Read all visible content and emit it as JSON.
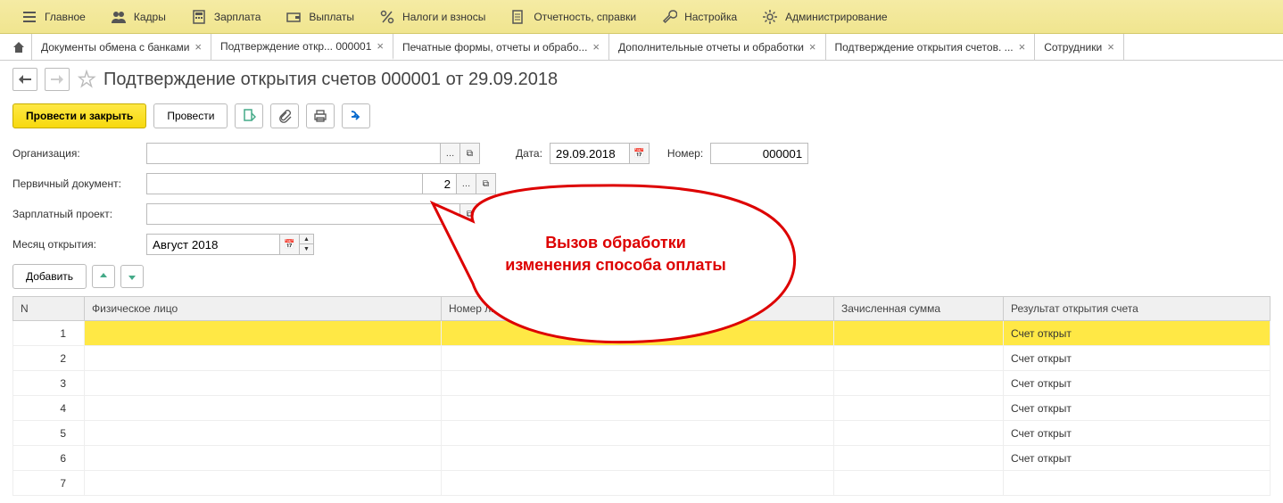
{
  "topmenu": [
    {
      "label": "Главное",
      "icon": "menu"
    },
    {
      "label": "Кадры",
      "icon": "people"
    },
    {
      "label": "Зарплата",
      "icon": "calc"
    },
    {
      "label": "Выплаты",
      "icon": "wallet"
    },
    {
      "label": "Налоги и взносы",
      "icon": "percent"
    },
    {
      "label": "Отчетность, справки",
      "icon": "report"
    },
    {
      "label": "Настройка",
      "icon": "wrench"
    },
    {
      "label": "Администрирование",
      "icon": "gear"
    }
  ],
  "tabs": [
    {
      "label": "Документы обмена с банками",
      "active": false
    },
    {
      "label": "Подтверждение откр...           000001",
      "active": true
    },
    {
      "label": "Печатные формы, отчеты и обрабо...",
      "active": false
    },
    {
      "label": "Дополнительные отчеты и обработки",
      "active": false
    },
    {
      "label": "Подтверждение открытия счетов. ...",
      "active": false
    },
    {
      "label": "Сотрудники",
      "active": false
    }
  ],
  "page": {
    "title": "Подтверждение открытия счетов        000001 от 29.09.2018",
    "buttons": {
      "primary": "Провести и закрыть",
      "secondary": "Провести",
      "add": "Добавить"
    }
  },
  "form": {
    "org_label": "Организация:",
    "org_value": "",
    "date_label": "Дата:",
    "date_value": "29.09.2018",
    "number_label": "Номер:",
    "number_value": "        000001",
    "primdoc_label": "Первичный документ:",
    "primdoc_value": "",
    "primdoc_value2": "2",
    "project_label": "Зарплатный проект:",
    "project_value": "",
    "month_label": "Месяц открытия:",
    "month_value": "Август 2018"
  },
  "callout": {
    "line1": "Вызов обработки",
    "line2": "изменения способа оплаты"
  },
  "table": {
    "headers": [
      "N",
      "Физическое лицо",
      "Номер лицевого счета",
      "Зачисленная сумма",
      "Результат открытия счета"
    ],
    "rows": [
      {
        "n": 1,
        "person": "",
        "account": "",
        "sum": "",
        "result": "Счет открыт",
        "selected": true
      },
      {
        "n": 2,
        "person": "",
        "account": "",
        "sum": "",
        "result": "Счет открыт"
      },
      {
        "n": 3,
        "person": "",
        "account": "",
        "sum": "",
        "result": "Счет открыт"
      },
      {
        "n": 4,
        "person": "",
        "account": "",
        "sum": "",
        "result": "Счет открыт"
      },
      {
        "n": 5,
        "person": "",
        "account": "",
        "sum": "",
        "result": "Счет открыт"
      },
      {
        "n": 6,
        "person": "",
        "account": "",
        "sum": "",
        "result": "Счет открыт"
      },
      {
        "n": 7,
        "person": "",
        "account": "",
        "sum": "",
        "result": ""
      }
    ]
  }
}
